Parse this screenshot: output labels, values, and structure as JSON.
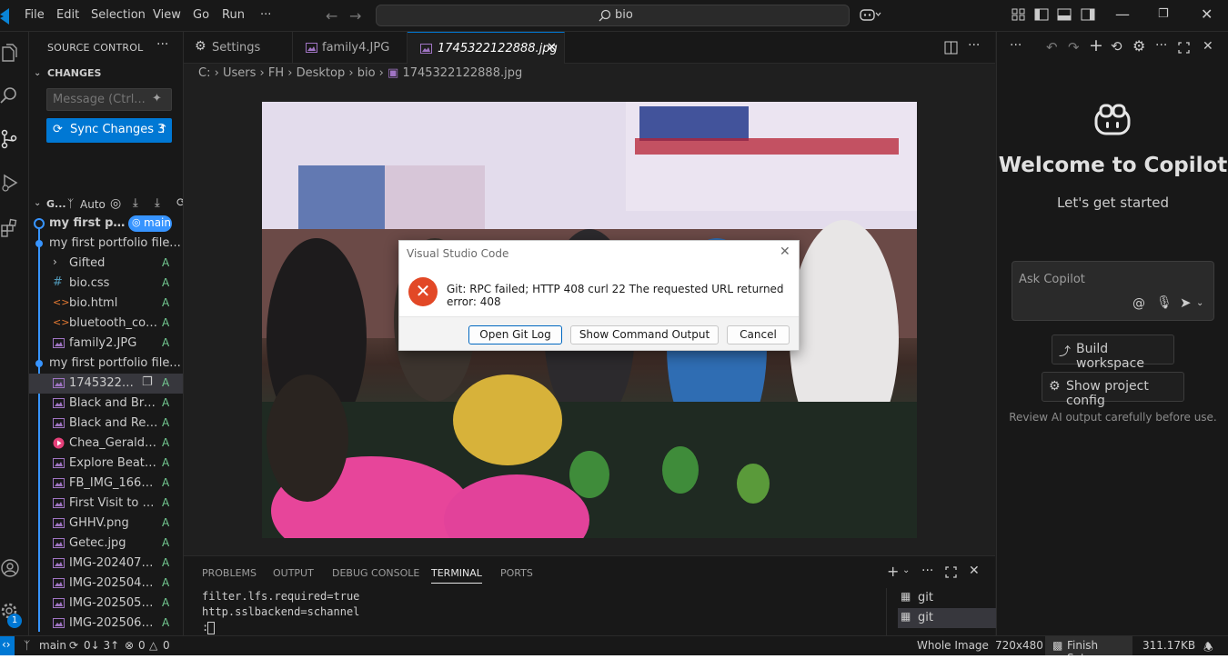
{
  "titlebar": {
    "menu": [
      "File",
      "Edit",
      "Selection",
      "View",
      "Go",
      "Run",
      "···"
    ],
    "search_text": "bio"
  },
  "sidebar": {
    "title": "SOURCE CONTROL",
    "changes_label": "CHANGES",
    "message_placeholder": "Message (Ctrl...",
    "sync_label": "Sync Changes 3",
    "graph_label": "G...",
    "graph_auto": "Auto",
    "branch_badge": "main",
    "commits": [
      {
        "label": "my first por...",
        "files": []
      },
      {
        "label": "my first portfolio file...",
        "files": [
          {
            "name": "Gifted",
            "status": "A",
            "kind": "folder"
          },
          {
            "name": "bio.css",
            "status": "A",
            "kind": "css"
          },
          {
            "name": "bio.html",
            "status": "A",
            "kind": "html"
          },
          {
            "name": "bluetooth_cont...",
            "status": "A",
            "kind": "html"
          },
          {
            "name": "family2.JPG",
            "status": "A",
            "kind": "image"
          }
        ]
      },
      {
        "label": "my first portfolio file...",
        "files": [
          {
            "name": "174532212...",
            "status": "A",
            "kind": "image"
          },
          {
            "name": "Black and Brow...",
            "status": "A",
            "kind": "image"
          },
          {
            "name": "Black and Red ...",
            "status": "A",
            "kind": "image"
          },
          {
            "name": "Chea_Gerald__...",
            "status": "A",
            "kind": "pdf"
          },
          {
            "name": "Explore Beaty ...",
            "status": "A",
            "kind": "image"
          },
          {
            "name": "FB_IMG_16685...",
            "status": "A",
            "kind": "image"
          },
          {
            "name": "First Visit to Sp...",
            "status": "A",
            "kind": "image"
          },
          {
            "name": "GHHV.png",
            "status": "A",
            "kind": "image"
          },
          {
            "name": "Getec.jpg",
            "status": "A",
            "kind": "image"
          },
          {
            "name": "IMG-20240721...",
            "status": "A",
            "kind": "image"
          },
          {
            "name": "IMG-20250414...",
            "status": "A",
            "kind": "image"
          },
          {
            "name": "IMG-20250501...",
            "status": "A",
            "kind": "image"
          },
          {
            "name": "IMG-20250616...",
            "status": "A",
            "kind": "image"
          }
        ]
      }
    ]
  },
  "tabs": [
    {
      "label": "Settings",
      "icon": "gear-icon"
    },
    {
      "label": "family4.JPG",
      "icon": "image-icon"
    },
    {
      "label": "1745322122888.jpg",
      "icon": "image-icon",
      "active": true
    }
  ],
  "breadcrumb": [
    "C:",
    "Users",
    "FH",
    "Desktop",
    "bio",
    "1745322122888.jpg"
  ],
  "dialog": {
    "title": "Visual Studio Code",
    "message": "Git: RPC failed; HTTP 408 curl 22 The requested URL returned error: 408",
    "buttons": [
      "Open Git Log",
      "Show Command Output",
      "Cancel"
    ]
  },
  "panel": {
    "tabs": [
      "PROBLEMS",
      "OUTPUT",
      "DEBUG CONSOLE",
      "TERMINAL",
      "PORTS"
    ],
    "active_tab": "TERMINAL",
    "terminal_lines": [
      "filter.lfs.required=true",
      "http.sslbackend=schannel",
      ":"
    ],
    "terminals": [
      "git",
      "git"
    ]
  },
  "chat": {
    "title": "Welcome to Copilot",
    "subtitle": "Let's get started",
    "placeholder": "Ask Copilot",
    "buttons": [
      "Build workspace",
      "Show project config"
    ],
    "note": "Review AI output carefully before use."
  },
  "statusbar": {
    "branch": "main",
    "sync": "0↓ 3↑",
    "errors": "0",
    "warnings": "0",
    "view_mode": "Whole Image",
    "dimensions": "720x480",
    "finish_setup": "Finish Setup",
    "file_size": "311.17KB"
  },
  "badge_count": "1",
  "colors": {
    "accent": "#0078d4",
    "added": "#73c991",
    "error": "#e24826"
  }
}
